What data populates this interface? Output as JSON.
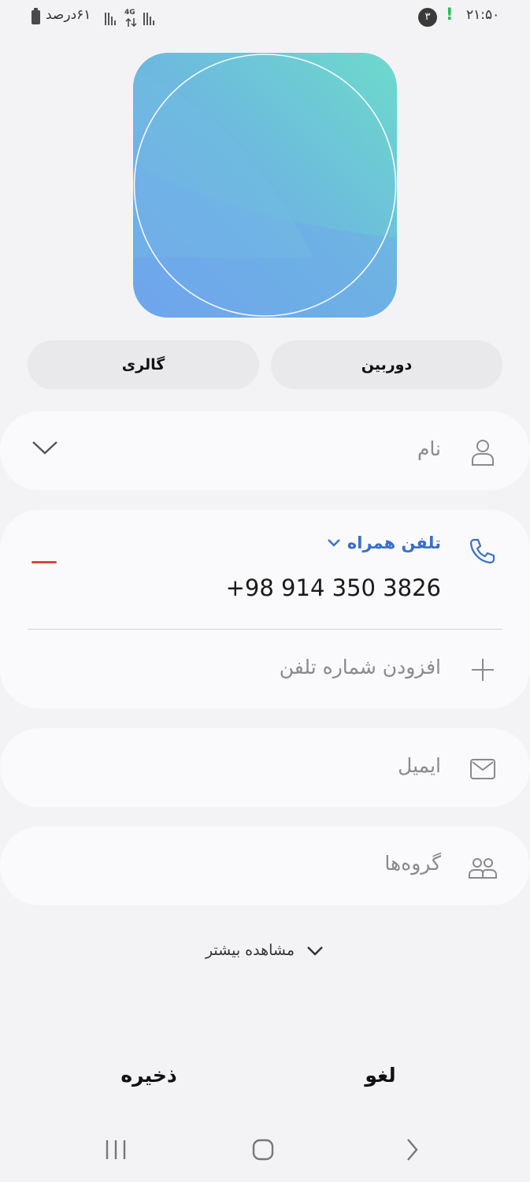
{
  "status_bar": {
    "time": "۲۱:۵۰",
    "notification_count": "۳",
    "alert_glyph": "!",
    "battery_text": "۶۱درصد",
    "network_type": "4G"
  },
  "photo": {
    "camera_label": "دوربین",
    "gallery_label": "گالری"
  },
  "fields": {
    "name_label": "نام",
    "phone_type": "تلفن همراه",
    "phone_number": "+98 914 350 3826",
    "add_phone_label": "افزودن شماره تلفن",
    "email_label": "ایمیل",
    "groups_label": "گروه‌ها",
    "view_more_label": "مشاهده بیشتر"
  },
  "actions": {
    "cancel_label": "لغو",
    "save_label": "ذخیره"
  },
  "colors": {
    "accent_blue": "#3a6fc8",
    "remove_red": "#d9483b",
    "alert_green": "#21c05b"
  },
  "icons": {
    "name": "person-icon",
    "phone": "phone-icon",
    "add": "plus-icon",
    "email": "envelope-icon",
    "groups": "people-icon",
    "expand": "chevron-down-icon"
  }
}
